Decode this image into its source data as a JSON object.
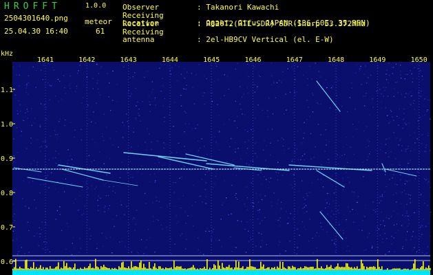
{
  "app": {
    "name": "HROFFT",
    "version": "1.0.0"
  },
  "file": {
    "name": "2504301640.png",
    "datetime": "25.04.30 16:40"
  },
  "detection": {
    "mode": "meteor",
    "count": "61"
  },
  "info": [
    {
      "key": "Observer",
      "value": ": Takanori Kawachi"
    },
    {
      "key": "Receiving Location",
      "value": ": Ogaki, Gifu, JAPAN (136.60E, 35.35N)"
    },
    {
      "key": "Receiver",
      "value": ": R820T2(RTL-SDR) SDR-Sharp 53.372MHz"
    },
    {
      "key": "Receiving antenna",
      "value": ": 2el-HB9CV Vertical (el. E-W)"
    }
  ],
  "axis": {
    "y_unit": "kHz",
    "x_ticks": [
      "1641",
      "1642",
      "1643",
      "1644",
      "1645",
      "1646",
      "1647",
      "1648",
      "1649",
      "1650"
    ],
    "y_ticks": [
      "1.1",
      "1.0",
      "0.9",
      "0.8",
      "0.7",
      "0.6"
    ]
  },
  "colors": {
    "background": "#0a0f6e",
    "text_green": "#2fd34a",
    "text_yellow": "#ffff44",
    "trail": "#7de8ff",
    "histogram": "#ffff00",
    "histogram_base": "#00e5ff"
  }
}
